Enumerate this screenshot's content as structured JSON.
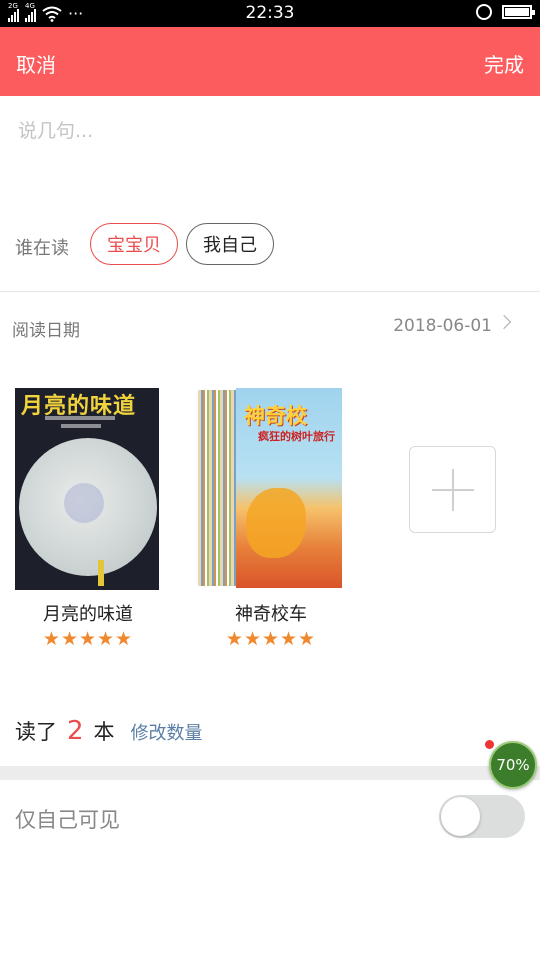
{
  "status_bar": {
    "sim1": "2G",
    "sim2": "4G",
    "more": "···",
    "time": "22:33"
  },
  "header": {
    "cancel": "取消",
    "done": "完成",
    "bg_color": "#fd5c5f"
  },
  "comment": {
    "placeholder": "说几句...",
    "value": ""
  },
  "reader": {
    "label": "谁在读",
    "options": [
      "宝宝贝",
      "我自己"
    ],
    "selected": "宝宝贝"
  },
  "date": {
    "label": "阅读日期",
    "value": "2018-06-01"
  },
  "books": [
    {
      "title": "月亮的味道",
      "cover_title": "月亮的味道",
      "rating": 5,
      "stars": "★★★★★"
    },
    {
      "title": "神奇校车",
      "cover_title": "神奇校",
      "cover_subtitle": "疯狂的树叶旅行",
      "rating": 5,
      "stars": "★★★★★"
    }
  ],
  "read_count": {
    "prefix": "读了",
    "count": "2",
    "suffix": "本",
    "edit_label": "修改数量"
  },
  "floating_badge": "70%",
  "privacy": {
    "label": "仅自己可见",
    "enabled": false
  },
  "colors": {
    "accent": "#ea4d4d",
    "star": "#f0882d",
    "link": "#5a7fa6"
  }
}
